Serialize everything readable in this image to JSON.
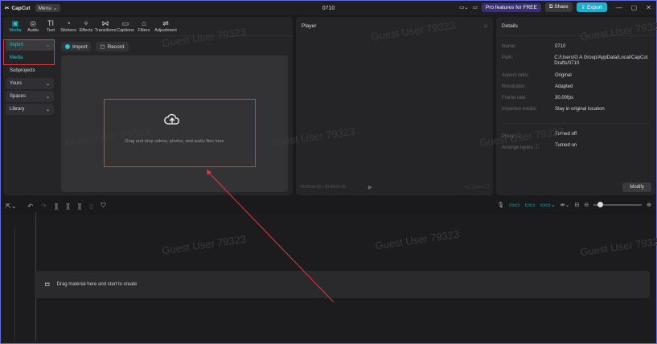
{
  "titlebar": {
    "logo": "CapCut",
    "menu": "Menu",
    "title": "0710",
    "pro": "Pro features for FREE",
    "share": "Share",
    "export": "Export"
  },
  "toolbar": {
    "items": [
      {
        "label": "Media",
        "icon": "media-icon"
      },
      {
        "label": "Audio",
        "icon": "audio-icon"
      },
      {
        "label": "Text",
        "icon": "text-icon"
      },
      {
        "label": "Stickers",
        "icon": "stickers-icon"
      },
      {
        "label": "Effects",
        "icon": "effects-icon"
      },
      {
        "label": "Transitions",
        "icon": "transitions-icon"
      },
      {
        "label": "Captions",
        "icon": "captions-icon"
      },
      {
        "label": "Filters",
        "icon": "filters-icon"
      },
      {
        "label": "Adjustment",
        "icon": "adjustment-icon"
      }
    ]
  },
  "sidebar": {
    "items": [
      {
        "label": "Import",
        "arrow": "⌄"
      },
      {
        "label": "Media",
        "arrow": ""
      },
      {
        "label": "Subprojects",
        "arrow": ""
      },
      {
        "label": "Yours",
        "arrow": "⌄"
      },
      {
        "label": "Spaces",
        "arrow": "⌄"
      },
      {
        "label": "Library",
        "arrow": "⌄"
      }
    ]
  },
  "media": {
    "import_label": "Import",
    "record_label": "Record",
    "drop_text": "Drag and drop videos, photos, and audio files here"
  },
  "player": {
    "title": "Player",
    "timecode": "00:00:00:00 | 00:00:00:00"
  },
  "details": {
    "title": "Details",
    "rows": [
      {
        "key": "Name:",
        "value": "0710"
      },
      {
        "key": "Path:",
        "value": "C:/Users/G A Group/AppData/Local/CapCut Drafts/0710"
      },
      {
        "key": "Aspect ratio:",
        "value": "Original"
      },
      {
        "key": "Resolution:",
        "value": "Adapted"
      },
      {
        "key": "Frame rate:",
        "value": "30.00fps"
      },
      {
        "key": "Imported media:",
        "value": "Stay in original location"
      },
      {
        "key": "Proxy: ⓘ",
        "value": "Turned off"
      },
      {
        "key": "Arrange layers ⓘ",
        "value": "Turned on"
      }
    ],
    "modify": "Modify"
  },
  "timeline": {
    "track_hint": "Drag material here and start to create"
  },
  "watermark": "Guest User 79323",
  "colors": {
    "accent": "#1fc9d8",
    "export": "#1fb0c9",
    "annotation": "#e03a3a"
  }
}
